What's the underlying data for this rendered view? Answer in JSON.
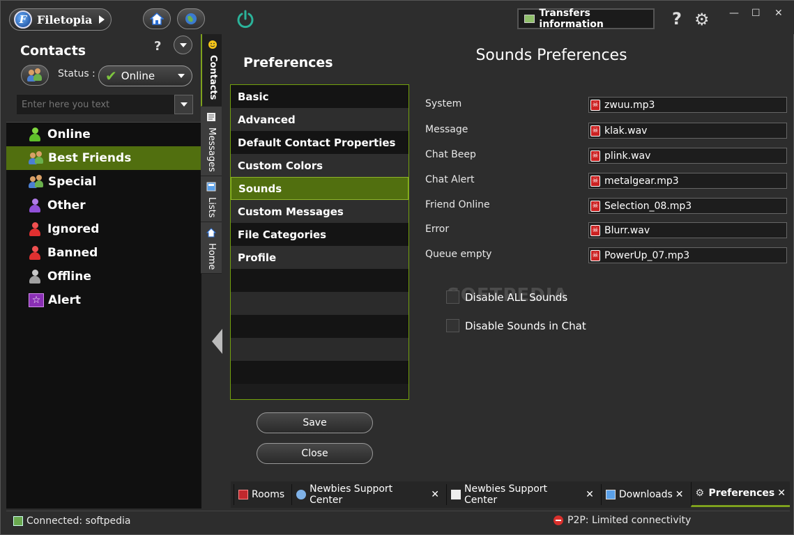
{
  "app": {
    "name": "Filetopia"
  },
  "topbar": {
    "transfers_label": "Transfers information"
  },
  "contacts": {
    "title": "Contacts",
    "status_label": "Status :",
    "status_value": "Online",
    "search_placeholder": "Enter here you text",
    "groups": [
      {
        "label": "Online",
        "icon": "green-person-icon"
      },
      {
        "label": "Best Friends",
        "icon": "two-persons-icon"
      },
      {
        "label": "Special",
        "icon": "two-persons-icon"
      },
      {
        "label": "Other",
        "icon": "purple-person-icon"
      },
      {
        "label": "Ignored",
        "icon": "red-person-icon"
      },
      {
        "label": "Banned",
        "icon": "red-person-icon"
      },
      {
        "label": "Offline",
        "icon": "gray-person-icon"
      },
      {
        "label": "Alert",
        "icon": "star-icon"
      }
    ],
    "selected": "Best Friends"
  },
  "vtabs": [
    {
      "label": "Contacts",
      "icon": "smiley-icon"
    },
    {
      "label": "Messages",
      "icon": "message-icon"
    },
    {
      "label": "Lists",
      "icon": "list-icon"
    },
    {
      "label": "Home",
      "icon": "home-icon"
    }
  ],
  "preferences": {
    "title": "Preferences",
    "items": [
      "Basic",
      "Advanced",
      "Default Contact Properties",
      "Custom Colors",
      "Sounds",
      "Custom Messages",
      "File Categories",
      "Profile"
    ],
    "selected": "Sounds",
    "save_label": "Save",
    "close_label": "Close"
  },
  "sounds": {
    "title": "Sounds Preferences",
    "rows": [
      {
        "label": "System",
        "file": "zwuu.mp3"
      },
      {
        "label": "Message",
        "file": "klak.wav"
      },
      {
        "label": "Chat Beep",
        "file": "plink.wav"
      },
      {
        "label": "Chat Alert",
        "file": "metalgear.mp3"
      },
      {
        "label": "Friend Online",
        "file": "Selection_08.mp3"
      },
      {
        "label": "Error",
        "file": "Blurr.wav"
      },
      {
        "label": "Queue empty",
        "file": "PowerUp_07.mp3"
      }
    ],
    "disable_all_label": "Disable ALL Sounds",
    "disable_chat_label": "Disable Sounds in Chat",
    "watermark": "SOFTPEDIA"
  },
  "bottom_tabs": [
    {
      "label": "Rooms",
      "closable": false
    },
    {
      "label": "Newbies Support Center",
      "closable": true
    },
    {
      "label": "Newbies Support Center",
      "closable": true
    },
    {
      "label": "Downloads",
      "closable": true
    },
    {
      "label": "Preferences",
      "closable": true
    }
  ],
  "status": {
    "connected": "Connected: softpedia",
    "p2p": "P2P: Limited connectivity"
  },
  "colors": {
    "accent": "#516f0f",
    "accent_border": "#73a10c"
  }
}
